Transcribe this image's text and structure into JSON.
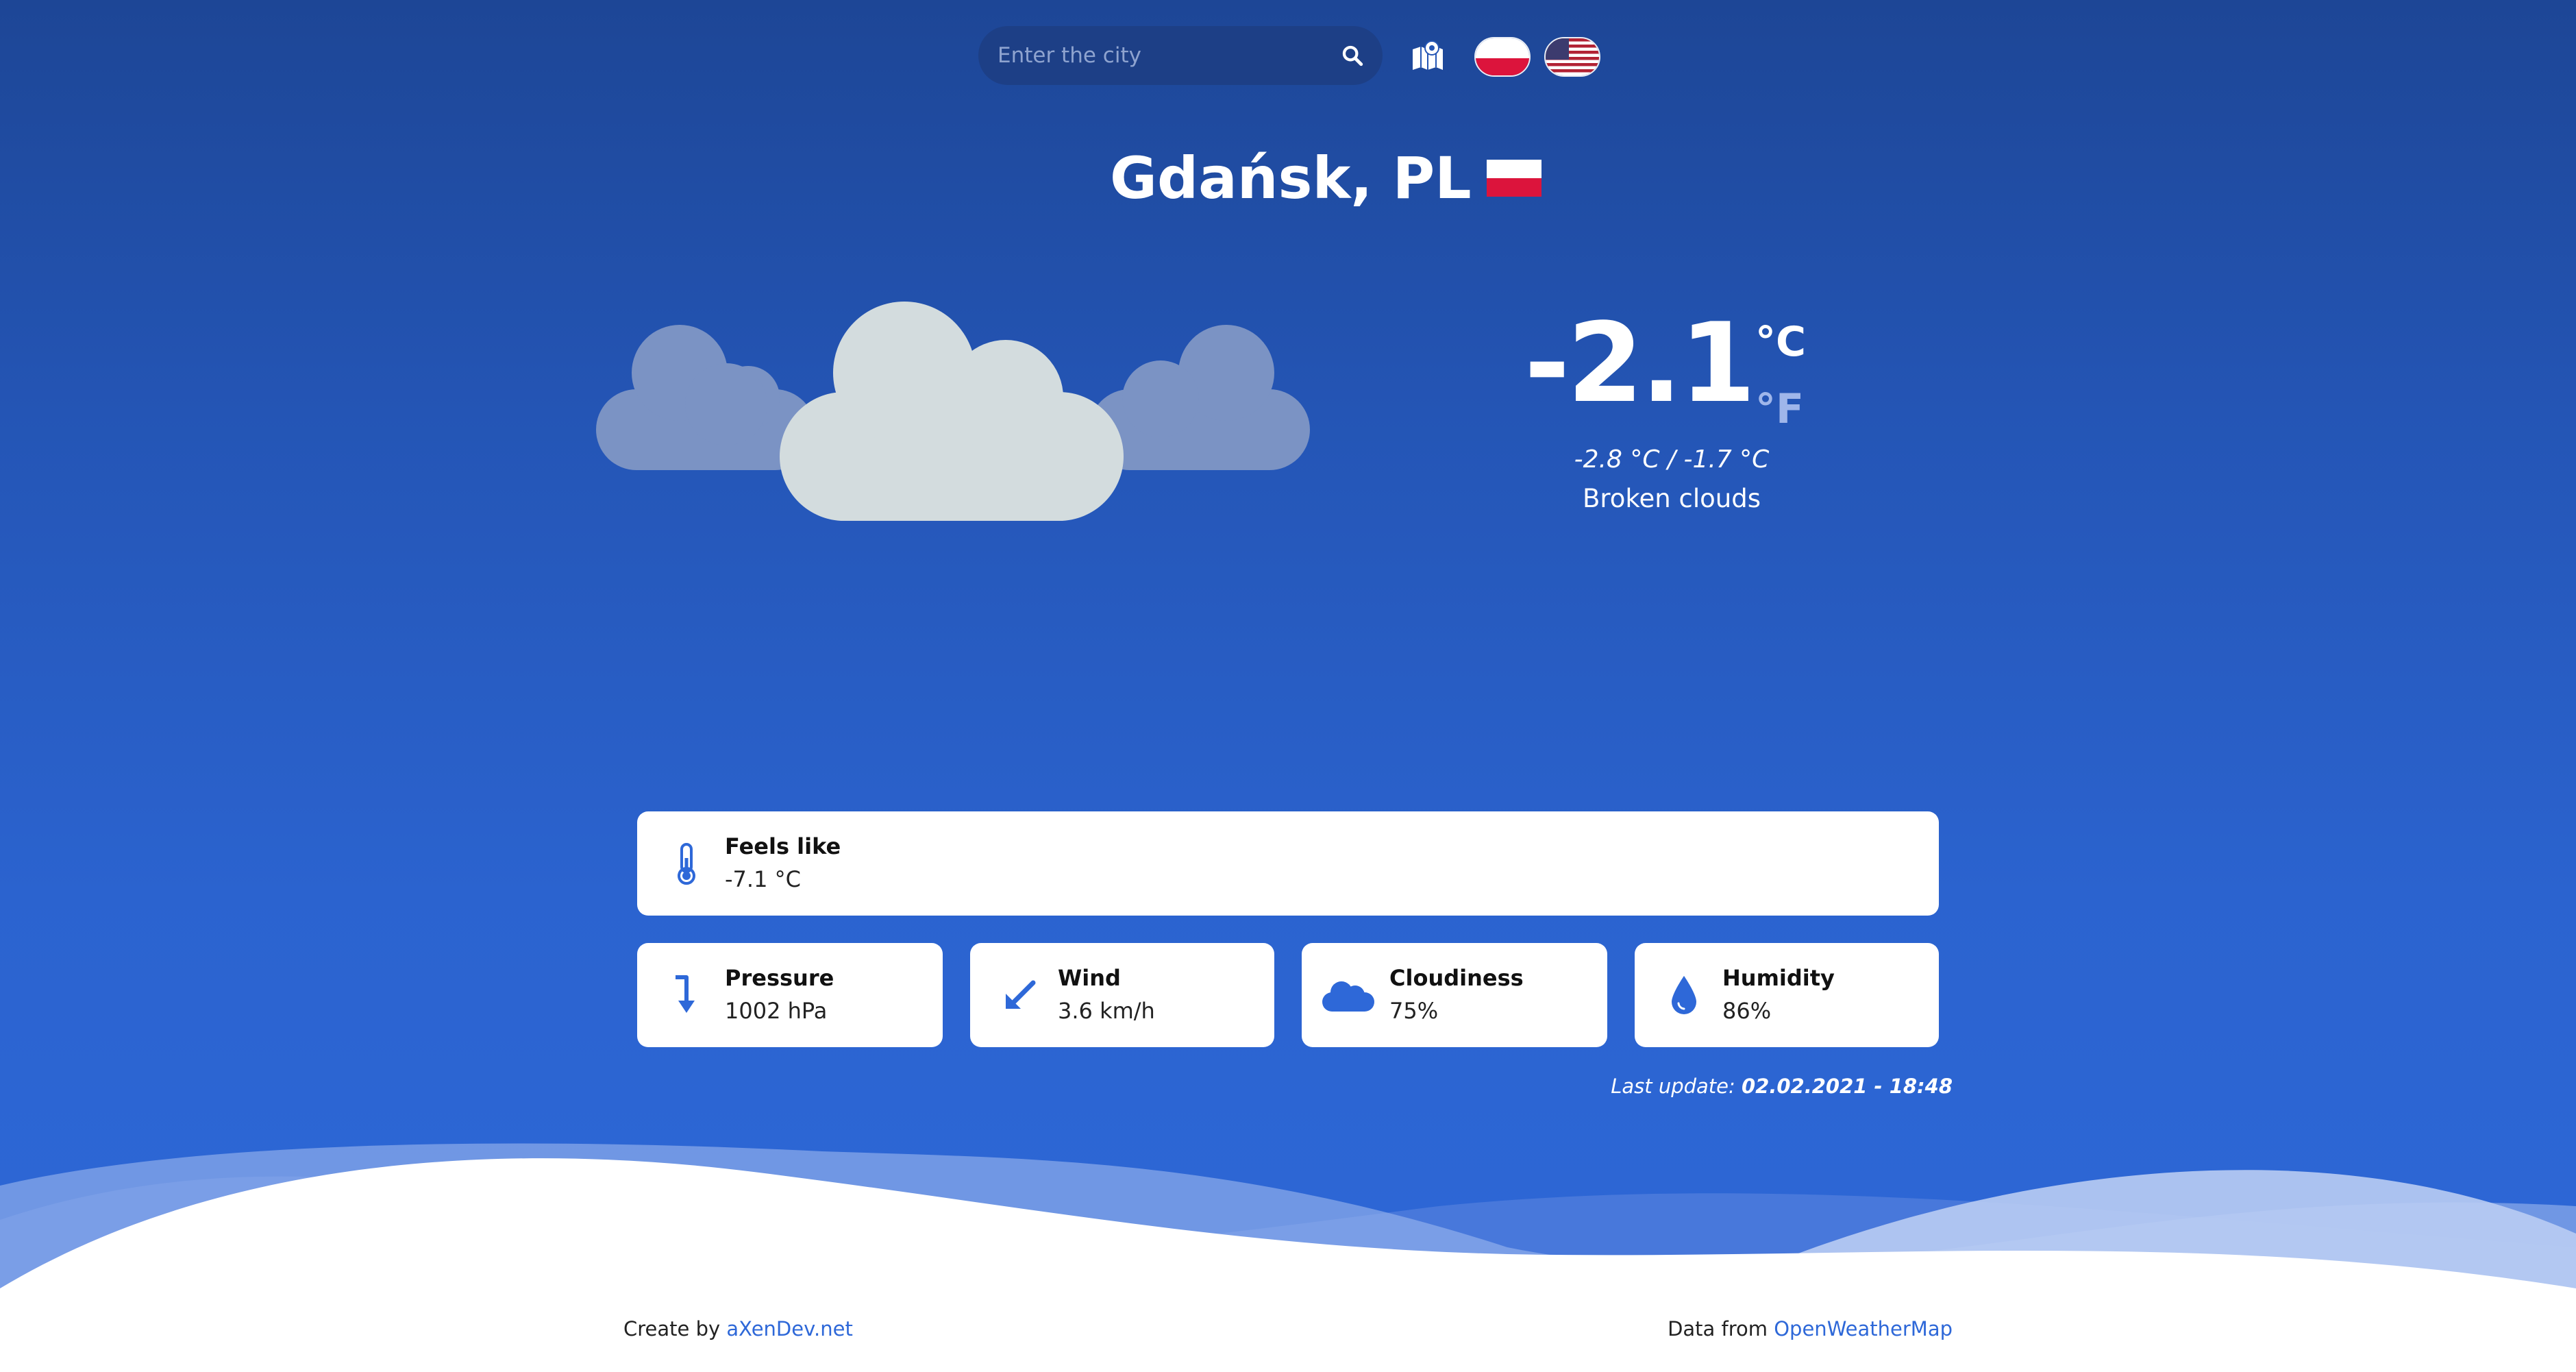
{
  "search": {
    "placeholder": "Enter the city"
  },
  "city": {
    "name": "Gdańsk, PL"
  },
  "weather": {
    "temp": "-2.1",
    "unit_c": "°C",
    "unit_f": "°F",
    "range": "-2.8 °C / -1.7 °C",
    "description": "Broken clouds"
  },
  "cards": {
    "feels": {
      "label": "Feels like",
      "value": "-7.1 °C"
    },
    "pressure": {
      "label": "Pressure",
      "value": "1002 hPa"
    },
    "wind": {
      "label": "Wind",
      "value": "3.6 km/h"
    },
    "cloudiness": {
      "label": "Cloudiness",
      "value": "75%"
    },
    "humidity": {
      "label": "Humidity",
      "value": "86%"
    }
  },
  "last_update": {
    "prefix": "Last update:",
    "value": "02.02.2021 - 18:48"
  },
  "footer": {
    "left_prefix": "Create by",
    "left_link": "aXenDev.net",
    "right_prefix": "Data from",
    "right_link": "OpenWeatherMap"
  },
  "colors": {
    "accent": "#2e68d8",
    "background_top": "#1d4696",
    "background_bottom": "#2e68d8",
    "card": "#ffffff"
  },
  "icons": {
    "search": "search-icon",
    "map": "map-pin-icon",
    "flag_pl": "flag-pl-icon",
    "flag_us": "flag-us-icon",
    "feels": "thermometer-icon",
    "pressure": "arrow-down-icon",
    "wind": "wind-arrow-icon",
    "cloudiness": "cloud-icon",
    "humidity": "droplet-icon"
  }
}
